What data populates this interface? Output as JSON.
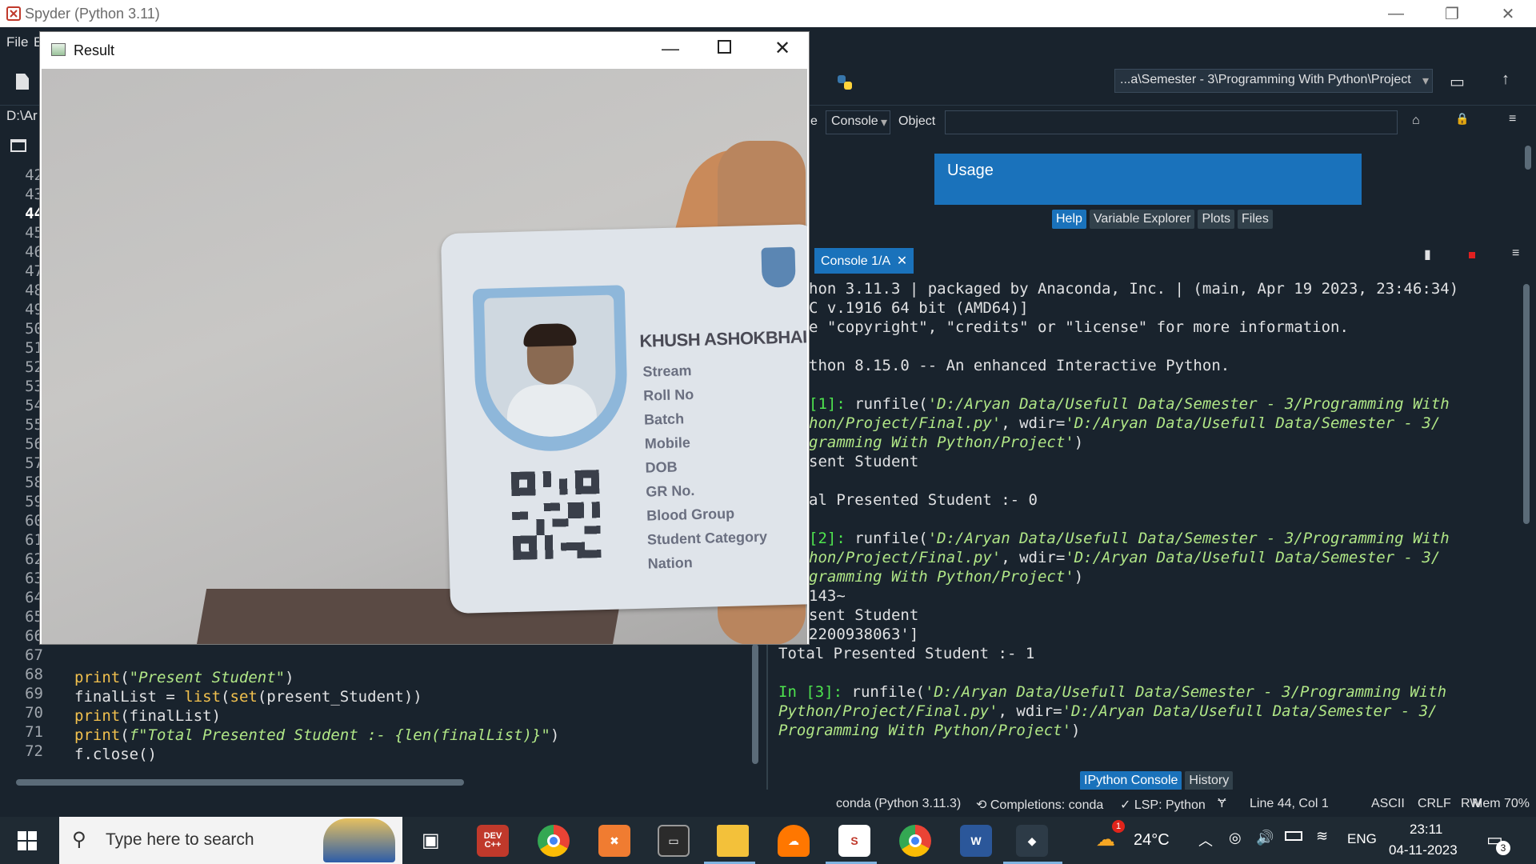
{
  "app": {
    "title": "Spyder (Python 3.11)"
  },
  "menu": {
    "file": "File",
    "edit_partial": "E"
  },
  "toolbar": {
    "path": "...a\\Semester - 3\\Programming With Python\\Project"
  },
  "editor": {
    "path_partial": "D:\\Ar",
    "gutter": [
      "42",
      "43",
      "44",
      "45",
      "46",
      "47",
      "48",
      "49",
      "50",
      "51",
      "52",
      "53",
      "54",
      "55",
      "56",
      "57",
      "58",
      "59",
      "60",
      "61",
      "62",
      "63",
      "64",
      "65",
      "66",
      "67",
      "68",
      "69",
      "70",
      "71",
      "72"
    ],
    "code": {
      "l68_fn": "print",
      "l68_open": "(",
      "l68_str": "\"Present Student\"",
      "l68_close": ")",
      "l69": "finalList = ",
      "l69_fn": "list",
      "l69_mid": "(",
      "l69_fn2": "set",
      "l69_rest": "(present_Student))",
      "l70_fn": "print",
      "l70_rest": "(finalList)",
      "l71_fn": "print",
      "l71_open": "(",
      "l71_str": "f\"Total Presented Student :- {len(finalList)}\"",
      "l71_close": ")",
      "l72": "f.close()"
    }
  },
  "help": {
    "source_partial": "e",
    "source_value": "Console",
    "object_label": "Object",
    "usage_title": "Usage",
    "tabs": [
      "Help",
      "Variable Explorer",
      "Plots",
      "Files"
    ]
  },
  "console": {
    "tab_label": "Console 1/A",
    "lines": {
      "l1": "hon 3.11.3 | packaged by Anaconda, Inc. | (main, Apr 19 2023, 23:46:34)",
      "l2": "C v.1916 64 bit (AMD64)]",
      "l3": "e \"copyright\", \"credits\" or \"license\" for more information.",
      "l4": "thon 8.15.0 -- An enhanced Interactive Python.",
      "l5_prompt": "[1]:",
      "l5_cmd": " runfile(",
      "l5_path": "'D:/Aryan Data/Usefull Data/Semester - 3/Programming With",
      "l6": "hon/Project/Final.py'",
      "l6_mid": ", wdir=",
      "l6_path": "'D:/Aryan Data/Usefull Data/Semester - 3/",
      "l7_path": "gramming With Python/Project'",
      "l7_close": ")",
      "l8": "sent Student",
      "l9": "al Presented Student :- 0",
      "l10_prompt": "[2]:",
      "l10_cmd": " runfile(",
      "l10_path": "'D:/Aryan Data/Usefull Data/Semester - 3/Programming With",
      "l11": "hon/Project/Final.py'",
      "l11_mid": ", wdir=",
      "l11_path": "'D:/Aryan Data/Usefull Data/Semester - 3/",
      "l12_path": "gramming With Python/Project'",
      "l12_close": ")",
      "l13": "143~",
      "l14": "sent Student",
      "l15": "2200938063']",
      "l16": "Total Presented Student :- 1",
      "l17_prompt": "In [3]:",
      "l17_cmd": " runfile(",
      "l17_path": "'D:/Aryan Data/Usefull Data/Semester - 3/Programming With",
      "l18_path": "Python/Project/Final.py'",
      "l18_mid": ", wdir=",
      "l18_path2": "'D:/Aryan Data/Usefull Data/Semester - 3/",
      "l19_path": "Programming With Python/Project'",
      "l19_close": ")"
    },
    "bottom_tabs": [
      "IPython Console",
      "History"
    ]
  },
  "status": {
    "conda": "conda (Python 3.11.3)",
    "completions": "Completions: conda",
    "lsp": "LSP: Python",
    "position": "Line 44, Col 1",
    "encoding": "ASCII",
    "eol": "CRLF",
    "mode": "RW",
    "mem": "Mem 70%"
  },
  "result_window": {
    "title": "Result",
    "card": {
      "name": "KHUSH ASHOKBHAI",
      "fields": [
        "Stream",
        "Roll No",
        "Batch",
        "Mobile",
        "DOB",
        "GR No.",
        "Blood Group",
        "Student Category",
        "Nation"
      ]
    }
  },
  "taskbar": {
    "search_placeholder": "Type here to search",
    "devcpp": "DEV C++",
    "weather": "24°C",
    "lang": "ENG",
    "time": "23:11",
    "date": "04-11-2023",
    "notif_count": "3",
    "weather_badge": "1"
  },
  "colors": {
    "accent": "#1a72bb",
    "bg": "#19232d",
    "prompt": "#4ee44e",
    "string": "#b0e686",
    "keyword": "#f2c14e"
  }
}
